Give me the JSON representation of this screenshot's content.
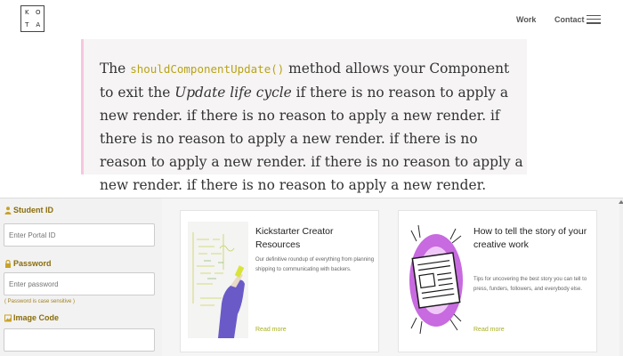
{
  "header": {
    "logo_letters": [
      "K",
      "O",
      "T",
      "A"
    ],
    "nav": {
      "work": "Work",
      "contact": "Contact"
    }
  },
  "quote": {
    "lead": "The ",
    "code": "shouldComponentUpdate()",
    "after_code": " method allows your Component to exit the ",
    "emphasis": "Update life cycle",
    "tail": " if there is no reason to apply a new render. if there is no reason to apply a new render. if there is no reason to apply a new render. if there is no reason to apply a new render. if there is no reason to apply a new render. if there is no reason to apply a new render."
  },
  "login": {
    "student_id_label": "Student ID",
    "student_id_placeholder": "Enter Portal ID",
    "password_label": "Password",
    "password_placeholder": "Enter password",
    "password_hint": "( Password is case sensitive )",
    "image_code_label": "Image Code"
  },
  "cards": [
    {
      "title": "Kickstarter Creator Resources",
      "description": "Our definitive roundup of everything from planning shipping to communicating with backers.",
      "link": "Read more",
      "icon": "whiteboard-hand-image"
    },
    {
      "title": "How to tell the story of your creative work",
      "description": "Tips for uncovering the best story you can tell to press, funders, followers, and everybody else.",
      "link": "Read more",
      "icon": "newspaper-illustration"
    }
  ],
  "colors": {
    "quote_border": "#f7c6e0",
    "code_color": "#b8a416",
    "label_color": "#8a6d0b",
    "link_color": "#a8b020",
    "card2_accent": "#b040d0"
  }
}
